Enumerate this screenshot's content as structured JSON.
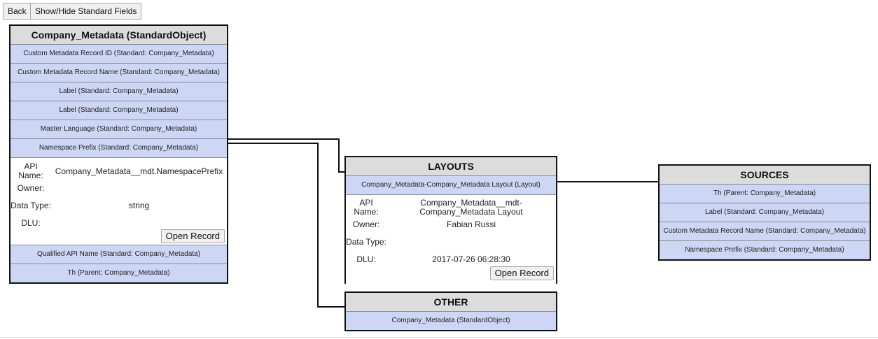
{
  "toolbar": {
    "back_label": "Back",
    "toggle_label": "Show/Hide Standard Fields"
  },
  "main_object": {
    "title": "Company_Metadata (StandardObject)",
    "fields_top": [
      "Custom Metadata Record ID (Standard: Company_Metadata)",
      "Custom Metadata Record Name (Standard: Company_Metadata)",
      "Label (Standard: Company_Metadata)",
      "Label (Standard: Company_Metadata)",
      "Master Language (Standard: Company_Metadata)",
      "Namespace Prefix (Standard: Company_Metadata)"
    ],
    "detail": {
      "api_name_label": "API Name:",
      "api_name": "Company_Metadata__mdt.NamespacePrefix",
      "owner_label": "Owner:",
      "owner": "",
      "data_type_label": "Data Type:",
      "data_type": "string",
      "dlu_label": "DLU:",
      "dlu": "",
      "open_record_label": "Open Record"
    },
    "fields_bottom": [
      "Qualified API Name (Standard: Company_Metadata)",
      "Th (Parent: Company_Metadata)"
    ]
  },
  "layouts": {
    "title": "LAYOUTS",
    "item": "Company_Metadata-Company_Metadata Layout (Layout)",
    "detail": {
      "api_name_label": "API Name:",
      "api_name": "Company_Metadata__mdt-Company_Metadata Layout",
      "owner_label": "Owner:",
      "owner": "Fabian Russi",
      "data_type_label": "Data Type:",
      "data_type": "",
      "dlu_label": "DLU:",
      "dlu": "2017-07-26 06:28:30",
      "open_record_label": "Open Record"
    }
  },
  "other": {
    "title": "OTHER",
    "item": "Company_Metadata (StandardObject)"
  },
  "sources": {
    "title": "SOURCES",
    "items": [
      "Th (Parent: Company_Metadata)",
      "Label (Standard: Company_Metadata)",
      "Custom Metadata Record Name (Standard: Company_Metadata)",
      "Namespace Prefix (Standard: Company_Metadata)"
    ]
  },
  "colors": {
    "field_bg": "#cdd6f5",
    "header_bg": "#dcdcdc",
    "border": "#111111"
  }
}
